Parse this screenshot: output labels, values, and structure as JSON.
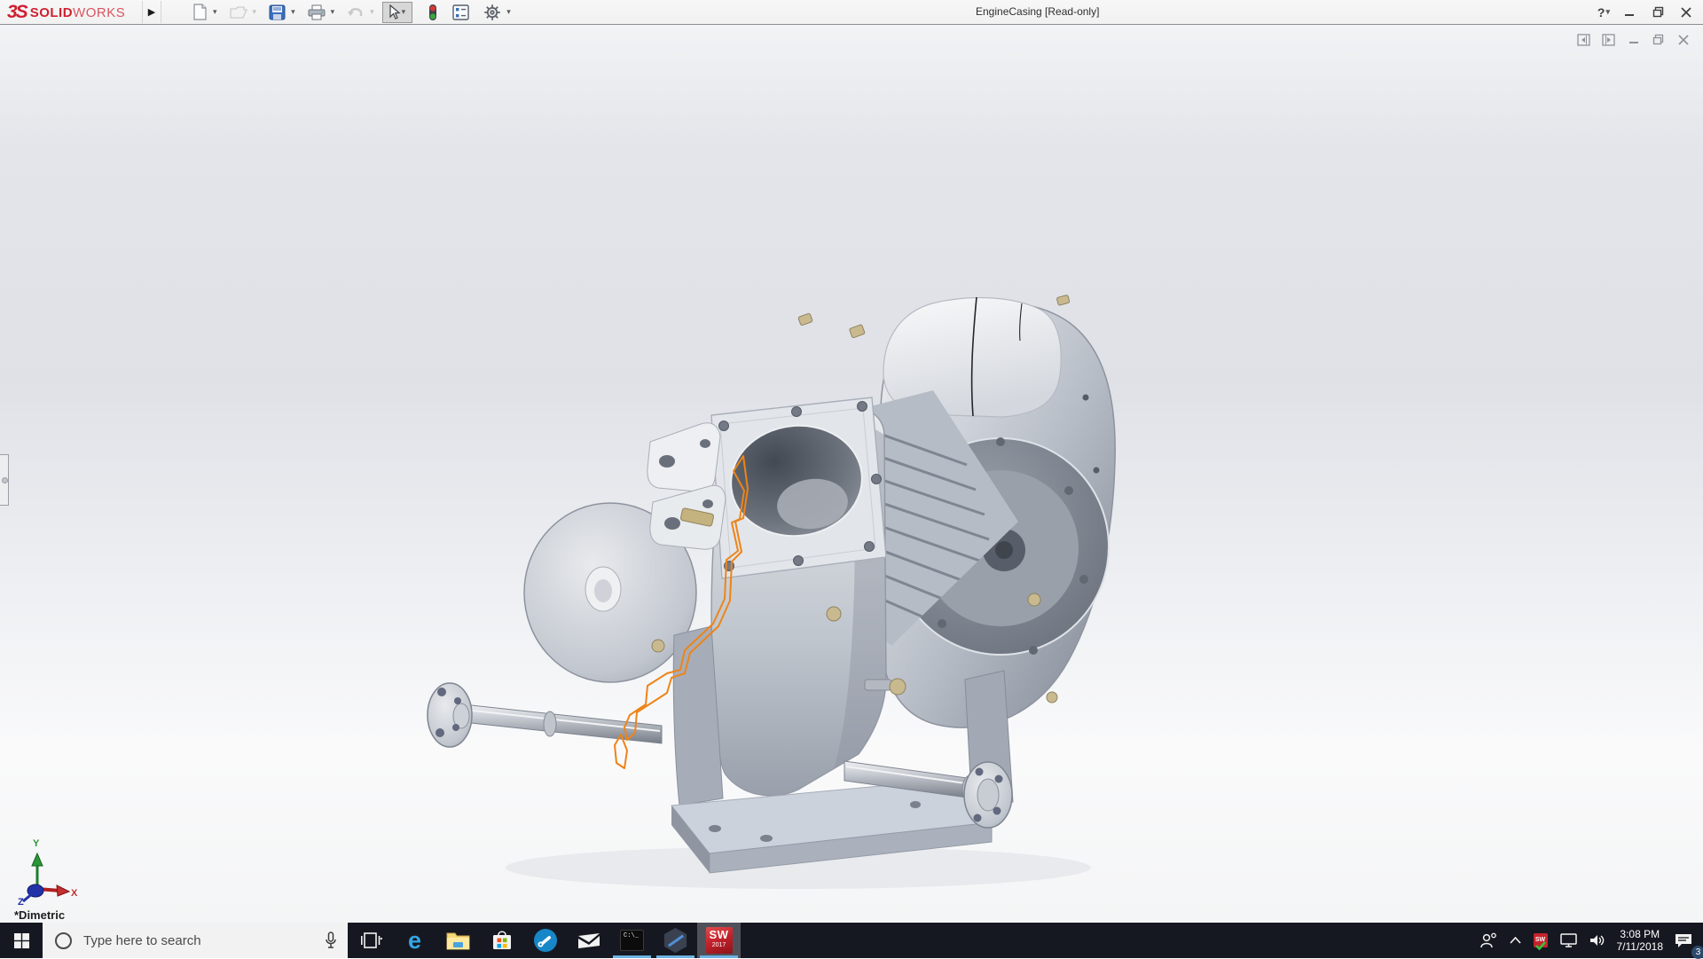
{
  "colors": {
    "solidworks_red": "#cf2030",
    "selection_orange": "#ee8418",
    "taskbar_bg": "#161821",
    "taskbar_accent_underline": "#6fb2e3",
    "active_app_bg": "#50525a",
    "viewport_gradient_top": "#e3e5ea",
    "viewport_gradient_bottom": "#fafafb",
    "store_squares": [
      "#f25022",
      "#7fba00",
      "#00a4ef",
      "#ffb900"
    ]
  },
  "title_bar": {
    "logo_mark": "3S",
    "logo_solid": "SOLID",
    "logo_works": "WORKS",
    "flyout_arrow": "▶",
    "document_title": "EngineCasing [Read-only]",
    "help_label": "?",
    "toolbar_icons": [
      "new-document",
      "open-document",
      "save",
      "print",
      "undo",
      "select-arrow",
      "rebuild-traffic-light",
      "file-properties",
      "options-gear"
    ]
  },
  "app_window_controls": [
    "minimize",
    "restore",
    "close"
  ],
  "document_window_controls": [
    "show-pane-left",
    "show-pane-right",
    "minimize",
    "restore",
    "close"
  ],
  "viewport": {
    "orientation_label": "*Dimetric",
    "triad_labels": {
      "x": "X",
      "y": "Y",
      "z": "Z"
    }
  },
  "taskbar": {
    "search_placeholder": "Type here to search",
    "app_icons": [
      "task-view",
      "edge",
      "file-explorer",
      "microsoft-store",
      "settings-tool",
      "mail",
      "command-prompt",
      "hexagon-app",
      "solidworks-2017"
    ],
    "running_apps": [
      "command-prompt",
      "hexagon-app",
      "solidworks-2017"
    ],
    "edge_glyph": "e",
    "cmd_glyph": "C:\\_",
    "sw_app": {
      "line1": "SW",
      "line2": "2017"
    },
    "tray": {
      "sw_tray_label": "SW",
      "time": "3:08 PM",
      "date": "7/11/2018",
      "notification_count": "3",
      "icons": [
        "people",
        "chevron-up",
        "solidworks-tray",
        "network",
        "volume",
        "clock",
        "action-center"
      ]
    }
  }
}
